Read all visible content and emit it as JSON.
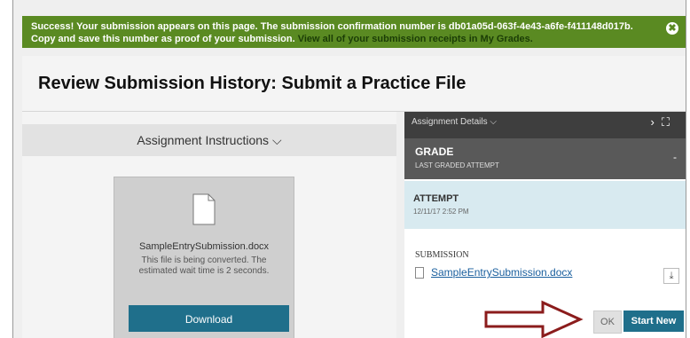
{
  "banner": {
    "message": "Success! Your submission appears on this page. The submission confirmation number is db01a05d-063f-4e43-a6fe-f411148d017b. Copy and save this number as proof of your submission.",
    "link_text": "View all of your submission receipts in My Grades.",
    "close_glyph": "✖"
  },
  "page": {
    "title": "Review Submission History: Submit a Practice File"
  },
  "left": {
    "instructions_label": "Assignment Instructions",
    "chevron": "⌵",
    "file_name": "SampleEntrySubmission.docx",
    "status_message": "This file is being converted. The estimated wait time is 2 seconds.",
    "download_label": "Download"
  },
  "right": {
    "details_label": "Assignment Details",
    "details_chevron": "⌵",
    "collapse_glyph": "›",
    "expand_glyph": "⛶",
    "grade_label": "GRADE",
    "grade_sub": "LAST GRADED ATTEMPT",
    "grade_value": "-",
    "attempt_label": "ATTEMPT",
    "attempt_datetime": "12/11/17 2:52 PM",
    "submission_label": "SUBMISSION",
    "submission_file": "SampleEntrySubmission.docx",
    "download_glyph": "⤓",
    "ok_label": "OK",
    "start_new_label": "Start New"
  },
  "colors": {
    "banner_green": "#5a8a22",
    "teal_button": "#1f6f8b",
    "arrow_red": "#8b1c1c"
  }
}
